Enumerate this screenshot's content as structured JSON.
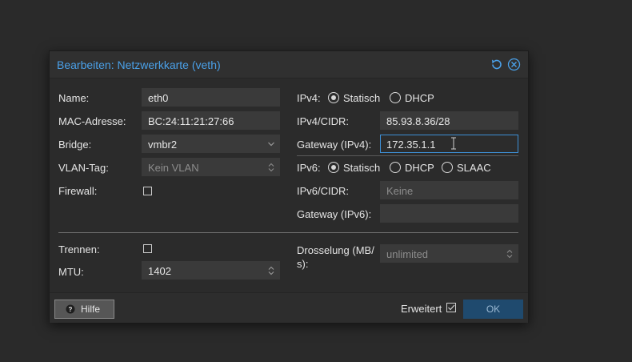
{
  "dialog": {
    "title": "Bearbeiten: Netzwerkkarte (veth)",
    "tools": {
      "reset_icon": "undo-icon",
      "close_icon": "close-icon"
    }
  },
  "left": {
    "name_label": "Name:",
    "name_value": "eth0",
    "mac_label": "MAC-Adresse:",
    "mac_value": "BC:24:11:21:27:66",
    "bridge_label": "Bridge:",
    "bridge_value": "vmbr2",
    "vlan_label": "VLAN-Tag:",
    "vlan_placeholder": "Kein VLAN",
    "firewall_label": "Firewall:",
    "firewall_checked": false
  },
  "right": {
    "ipv4_label": "IPv4:",
    "ipv4_options": [
      "Statisch",
      "DHCP"
    ],
    "ipv4_selected": "Statisch",
    "ipv4cidr_label": "IPv4/CIDR:",
    "ipv4cidr_value": "85.93.8.36/28",
    "gw4_label": "Gateway (IPv4):",
    "gw4_value": "172.35.1.1",
    "ipv6_label": "IPv6:",
    "ipv6_options": [
      "Statisch",
      "DHCP",
      "SLAAC"
    ],
    "ipv6_selected": "Statisch",
    "ipv6cidr_label": "IPv6/CIDR:",
    "ipv6cidr_placeholder": "Keine",
    "gw6_label": "Gateway (IPv6):",
    "gw6_value": ""
  },
  "advanced": {
    "disconnect_label": "Trennen:",
    "disconnect_checked": false,
    "mtu_label": "MTU:",
    "mtu_value": "1402",
    "rate_label_line1": "Drosselung (MB/",
    "rate_label_line2": "s):",
    "rate_placeholder": "unlimited"
  },
  "footer": {
    "help_label": "Hilfe",
    "help_icon": "question-circle-icon",
    "advanced_label": "Erweitert",
    "advanced_checked": true,
    "ok_label": "OK"
  },
  "colors": {
    "accent": "#4aa0e8",
    "ok_button": "#1f4a6e",
    "focus_border": "#3d8fd6"
  }
}
